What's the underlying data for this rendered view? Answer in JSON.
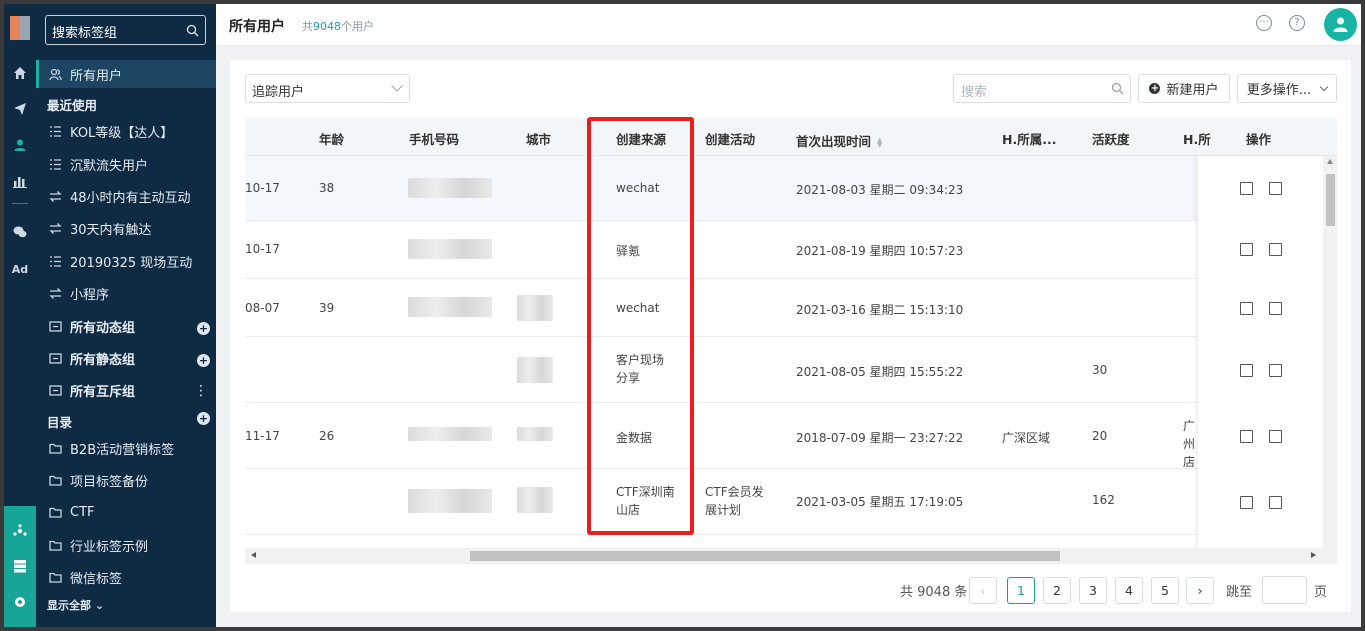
{
  "sidebar": {
    "search_placeholder": "搜索标签组",
    "items": [
      {
        "label": "所有用户"
      },
      {
        "label": "KOL等级【达人】"
      },
      {
        "label": "沉默流失用户"
      },
      {
        "label": "48小时内有主动互动"
      },
      {
        "label": "30天内有触达"
      },
      {
        "label": "20190325 现场互动"
      },
      {
        "label": "小程序"
      },
      {
        "label": "所有动态组"
      },
      {
        "label": "所有静态组"
      },
      {
        "label": "所有互斥组"
      },
      {
        "label": "B2B活动营销标签"
      },
      {
        "label": "项目标签备份"
      },
      {
        "label": "CTF"
      },
      {
        "label": "行业标签示例"
      },
      {
        "label": "微信标签"
      }
    ],
    "recent_label": "最近使用",
    "catalog_label": "目录",
    "show_all": "显示全部"
  },
  "rail": {
    "ad_label": "Ad"
  },
  "header": {
    "title": "所有用户",
    "count_prefix": "共",
    "count_value": "9048",
    "count_suffix": "个用户"
  },
  "toolbar": {
    "filter_value": "追踪用户",
    "search_placeholder": "搜索",
    "new_user": "新建用户",
    "more_ops": "更多操作..."
  },
  "table": {
    "columns": [
      "年龄",
      "手机号码",
      "城市",
      "创建来源",
      "创建活动",
      "首次出现时间",
      "H.所属...",
      "活跃度",
      "H.所",
      "操作"
    ],
    "rows": [
      {
        "date_frag": "10-17",
        "age": "38",
        "source": "wechat",
        "campaign": "",
        "first_seen": "2021-08-03 星期二 09:34:23",
        "region": "",
        "activity": "",
        "store": ""
      },
      {
        "date_frag": "10-17",
        "age": "",
        "source": "驿氪",
        "campaign": "",
        "first_seen": "2021-08-19 星期四 10:57:23",
        "region": "",
        "activity": "",
        "store": ""
      },
      {
        "date_frag": "08-07",
        "age": "39",
        "source": "wechat",
        "campaign": "",
        "first_seen": "2021-03-16 星期二 15:13:10",
        "region": "",
        "activity": "",
        "store": ""
      },
      {
        "date_frag": "",
        "age": "",
        "source": "客户现场分享",
        "campaign": "",
        "first_seen": "2021-08-05 星期四 15:55:22",
        "region": "",
        "activity": "30",
        "store": ""
      },
      {
        "date_frag": "11-17",
        "age": "26",
        "source": "金数据",
        "campaign": "",
        "first_seen": "2018-07-09 星期一 23:27:22",
        "region": "广深区域",
        "activity": "20",
        "store": "广州店"
      },
      {
        "date_frag": "",
        "age": "",
        "source": "CTF深圳南山店",
        "campaign": "CTF会员发展计划",
        "first_seen": "2021-03-05 星期五 17:19:05",
        "region": "",
        "activity": "162",
        "store": ""
      }
    ]
  },
  "pagination": {
    "total": "共 9048 条",
    "pages": [
      "1",
      "2",
      "3",
      "4",
      "5"
    ],
    "current": "1",
    "jump_label": "跳至",
    "page_label": "页"
  },
  "colors": {
    "sidebar_bg": "#0f2b44",
    "accent": "#17b3a3",
    "highlight_box": "#ee1c1c"
  }
}
